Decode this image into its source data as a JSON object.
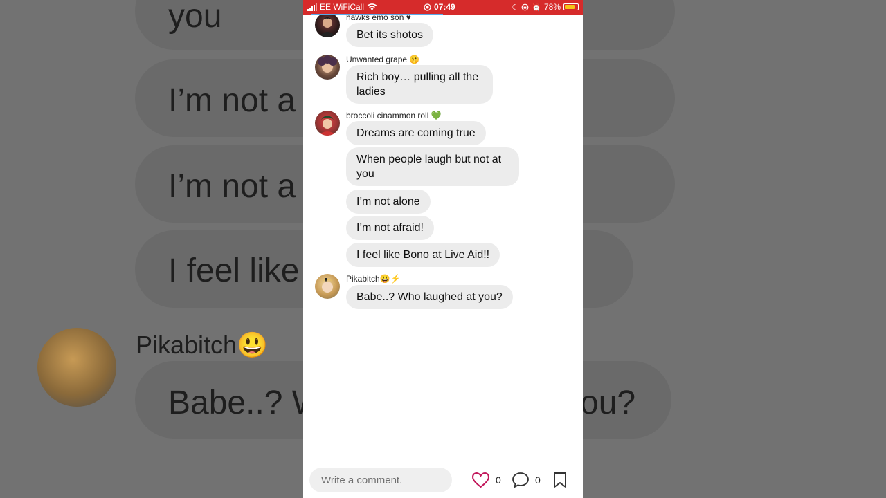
{
  "status_bar": {
    "carrier": "EE WiFiCall",
    "time": "07:49",
    "battery": "78%",
    "battery_level": 0.78
  },
  "messages": [
    {
      "sender": "hawks emo son",
      "bubbles": [
        "Bet its shotos"
      ]
    },
    {
      "sender": "Unwanted grape 🤫",
      "bubbles": [
        "Rich boy… pulling all the ladies"
      ]
    },
    {
      "sender": "broccoli cinammon roll 💚",
      "bubbles": [
        "Dreams are coming true",
        "When people laugh but not at you",
        "I’m not alone",
        "I’m not afraid!",
        "I feel like Bono at Live Aid!!"
      ]
    },
    {
      "sender": "Pikabitch😃⚡",
      "bubbles": [
        "Babe..? Who laughed at you?"
      ]
    }
  ],
  "bottom_bar": {
    "comment_placeholder": "Write a comment.",
    "likes_count": "0",
    "comments_count": "0"
  },
  "background_zoom": {
    "lines": [
      "you",
      "I’m not a",
      "I’m not a",
      "I feel like",
      "Babe..? W",
      "ou?",
      "!!"
    ],
    "sender": "Pikabitch😃"
  },
  "colors": {
    "status_bar": "#d62b2b",
    "bubble": "#ececec",
    "heart": "#c2185b"
  }
}
